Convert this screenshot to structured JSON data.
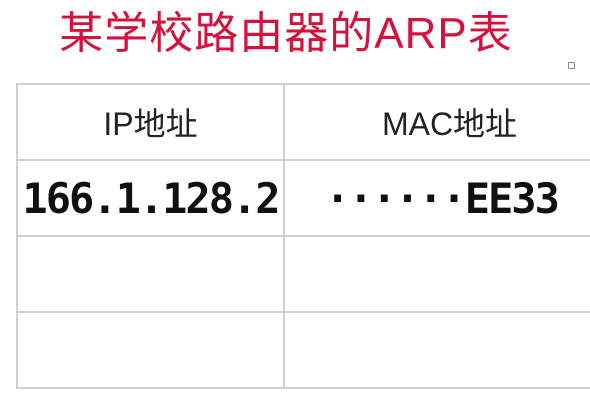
{
  "title": "某学校路由器的ARP表",
  "table": {
    "headers": [
      "IP地址",
      "MAC地址"
    ],
    "rows": [
      [
        "166.1.128.2",
        "······EE33"
      ],
      [
        "",
        ""
      ],
      [
        "",
        ""
      ]
    ]
  },
  "colors": {
    "title": "#d4123c",
    "grid": "#cfcfcf"
  }
}
